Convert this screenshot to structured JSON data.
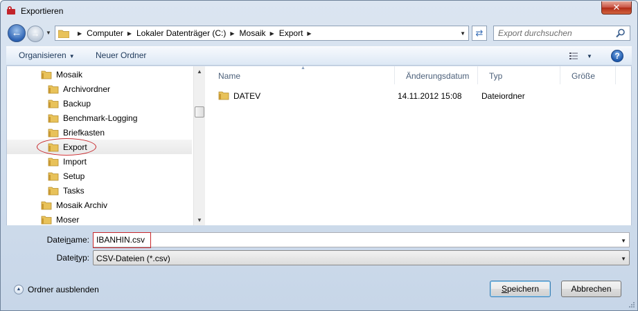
{
  "window": {
    "title": "Exportieren",
    "close_label": "✕"
  },
  "address": {
    "crumbs": [
      "Computer",
      "Lokaler Datenträger (C:)",
      "Mosaik",
      "Export"
    ]
  },
  "search": {
    "placeholder": "Export durchsuchen"
  },
  "toolbar": {
    "organize_label": "Organisieren",
    "new_folder_label": "Neuer Ordner",
    "help_label": "?"
  },
  "tree": {
    "items": [
      {
        "label": "Mosaik",
        "level": 1
      },
      {
        "label": "Archivordner",
        "level": 2
      },
      {
        "label": "Backup",
        "level": 2
      },
      {
        "label": "Benchmark-Logging",
        "level": 2
      },
      {
        "label": "Briefkasten",
        "level": 2
      },
      {
        "label": "Export",
        "level": 2,
        "selected": true
      },
      {
        "label": "Import",
        "level": 2
      },
      {
        "label": "Setup",
        "level": 2
      },
      {
        "label": "Tasks",
        "level": 2
      },
      {
        "label": "Mosaik Archiv",
        "level": 1
      },
      {
        "label": "Moser",
        "level": 1
      }
    ]
  },
  "filelist": {
    "columns": [
      "Name",
      "Änderungsdatum",
      "Typ",
      "Größe"
    ],
    "rows": [
      {
        "name": "DATEV",
        "date": "14.11.2012 15:08",
        "type": "Dateiordner",
        "size": ""
      }
    ]
  },
  "form": {
    "filename_label_pre": "Datei",
    "filename_label_u": "n",
    "filename_label_post": "ame:",
    "filename_value": "IBANHIN.csv",
    "filetype_label_pre": "Datei",
    "filetype_label_u": "t",
    "filetype_label_post": "yp:",
    "filetype_value": "CSV-Dateien (*.csv)"
  },
  "footer": {
    "hide_folders_label": "Ordner ausblenden",
    "save_label_u": "S",
    "save_label_rest": "peichern",
    "cancel_label": "Abbrechen"
  },
  "colors": {
    "highlight_red": "#c7262a",
    "title_blue": "#1e395b",
    "folder_yellow": "#e8c25a"
  }
}
